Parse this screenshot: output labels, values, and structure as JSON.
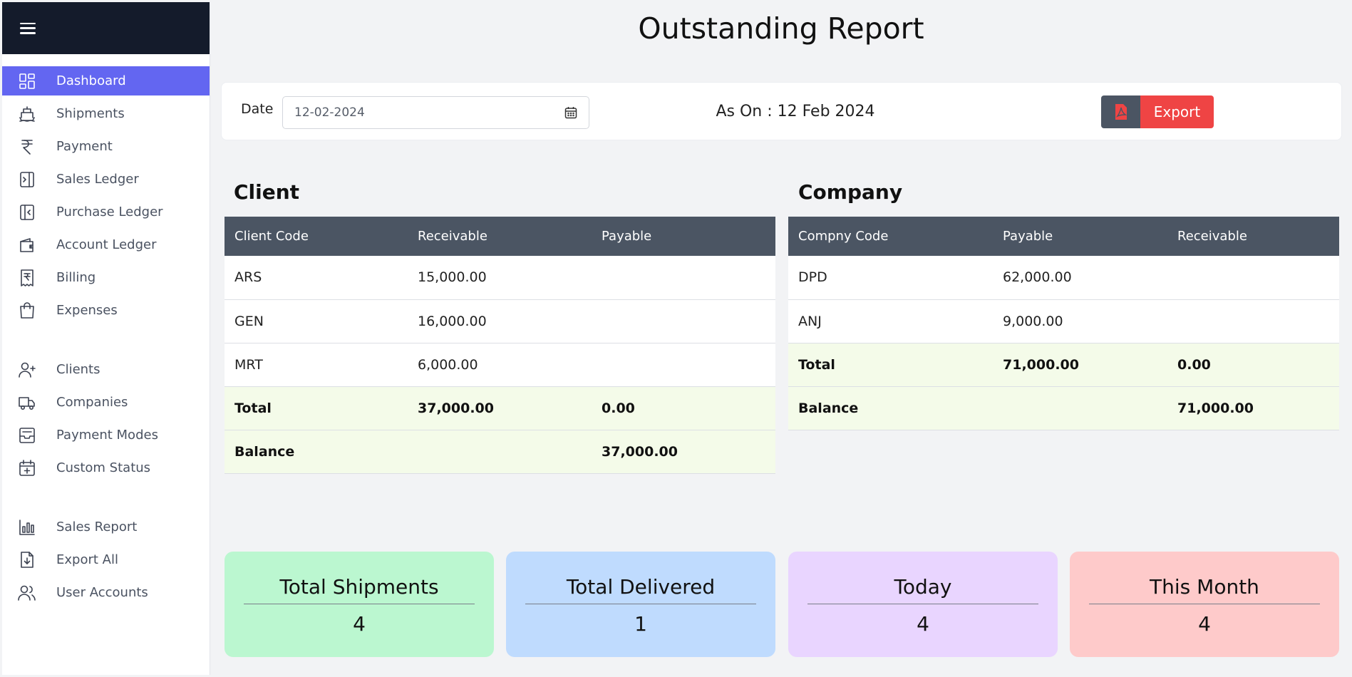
{
  "sidebar": {
    "groups": [
      [
        {
          "label": "Dashboard",
          "icon": "dashboard-icon",
          "active": true
        },
        {
          "label": "Shipments",
          "icon": "ship-icon"
        },
        {
          "label": "Payment",
          "icon": "rupee-icon"
        },
        {
          "label": "Sales Ledger",
          "icon": "sales-ledger-icon"
        },
        {
          "label": "Purchase Ledger",
          "icon": "purchase-ledger-icon"
        },
        {
          "label": "Account Ledger",
          "icon": "wallet-icon"
        },
        {
          "label": "Billing",
          "icon": "receipt-icon"
        },
        {
          "label": "Expenses",
          "icon": "shopping-bag-icon"
        }
      ],
      [
        {
          "label": "Clients",
          "icon": "user-plus-icon"
        },
        {
          "label": "Companies",
          "icon": "truck-icon"
        },
        {
          "label": "Payment Modes",
          "icon": "inbox-icon"
        },
        {
          "label": "Custom Status",
          "icon": "calendar-plus-icon"
        }
      ],
      [
        {
          "label": "Sales Report",
          "icon": "bar-chart-icon"
        },
        {
          "label": "Export All",
          "icon": "file-download-icon"
        },
        {
          "label": "User Accounts",
          "icon": "users-icon"
        }
      ]
    ]
  },
  "page": {
    "title": "Outstanding Report"
  },
  "filter": {
    "date_label": "Date",
    "date_value": "12-02-2024",
    "as_on": "As On : 12 Feb 2024",
    "export_label": "Export"
  },
  "client": {
    "title": "Client",
    "headers": [
      "Client Code",
      "Receivable",
      "Payable"
    ],
    "rows": [
      [
        "ARS",
        "15,000.00",
        ""
      ],
      [
        "GEN",
        "16,000.00",
        ""
      ],
      [
        "MRT",
        "6,000.00",
        ""
      ]
    ],
    "summary": [
      [
        "Total",
        "37,000.00",
        "0.00"
      ],
      [
        "Balance",
        "",
        "37,000.00"
      ]
    ]
  },
  "company": {
    "title": "Company",
    "headers": [
      "Compny Code",
      "Payable",
      "Receivable"
    ],
    "rows": [
      [
        "DPD",
        "62,000.00",
        ""
      ],
      [
        "ANJ",
        "9,000.00",
        ""
      ]
    ],
    "summary": [
      [
        "Total",
        "71,000.00",
        "0.00"
      ],
      [
        "Balance",
        "",
        "71,000.00"
      ]
    ]
  },
  "stats": [
    {
      "title": "Total Shipments",
      "value": "4",
      "color": "#bbf7d0"
    },
    {
      "title": "Total Delivered",
      "value": "1",
      "color": "#bfdbfe"
    },
    {
      "title": "Today",
      "value": "4",
      "color": "#e9d5ff"
    },
    {
      "title": "This Month",
      "value": "4",
      "color": "#fecaca"
    }
  ]
}
